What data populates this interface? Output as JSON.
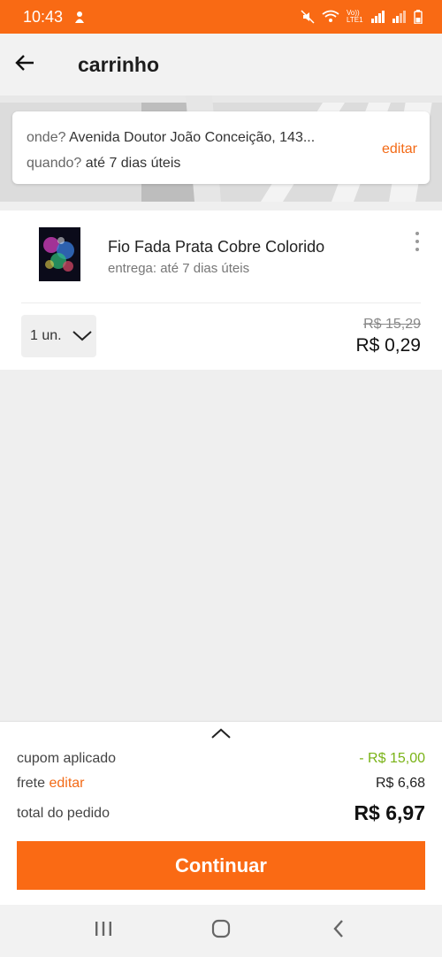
{
  "status_bar": {
    "time": "10:43",
    "network_label": "Vo)) LTE1"
  },
  "header": {
    "title": "carrinho"
  },
  "delivery": {
    "where_label": "onde?",
    "where_value": "Avenida Doutor João Conceição, 143...",
    "when_label": "quando?",
    "when_value": "até 7 dias úteis",
    "edit_label": "editar"
  },
  "product": {
    "name": "Fio Fada Prata Cobre Colorido",
    "delivery_text": "entrega: até 7 dias úteis",
    "quantity": "1 un.",
    "price_old": "R$ 15,29",
    "price_new": "R$ 0,29"
  },
  "summary": {
    "coupon_label": "cupom aplicado",
    "coupon_value": "- R$ 15,00",
    "freight_label": "frete",
    "freight_edit": "editar",
    "freight_value": "R$ 6,68",
    "total_label": "total do pedido",
    "total_value": "R$ 6,97",
    "continue_label": "Continuar"
  },
  "colors": {
    "accent": "#f96a14",
    "discount": "#7ab317",
    "background": "#efefef"
  },
  "icons": [
    "back-arrow-icon",
    "more-vert-icon",
    "chevron-down-icon",
    "chevron-up-icon",
    "recents-icon",
    "home-icon",
    "nav-back-icon"
  ]
}
